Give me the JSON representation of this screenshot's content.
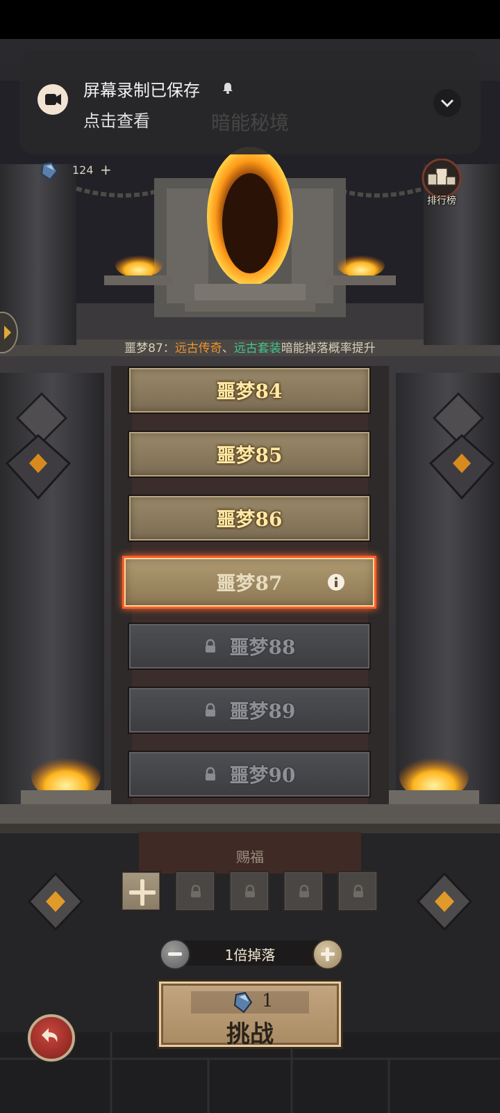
{
  "notification": {
    "title": "屏幕录制已保存",
    "subtitle": "点击查看",
    "icon": "video-camera-icon",
    "expand_icon": "chevron-down-icon"
  },
  "header": {
    "title": "暗能秘境"
  },
  "currency": {
    "icon": "crystal-gem-icon",
    "count": "124",
    "add": "+"
  },
  "leaderboard": {
    "label": "排行榜",
    "icon": "podium-icon"
  },
  "notice": {
    "prefix": "噩梦87：",
    "item1": "远古传奇",
    "separator": "、",
    "item2": "远古套装",
    "suffix": "暗能掉落概率提升",
    "color_item1": "#f0932c",
    "color_item2": "#43c88d"
  },
  "levels": [
    {
      "label": "噩梦84",
      "state": "open"
    },
    {
      "label": "噩梦85",
      "state": "open"
    },
    {
      "label": "噩梦86",
      "state": "open"
    },
    {
      "label": "噩梦87",
      "state": "selected"
    },
    {
      "label": "噩梦88",
      "state": "locked"
    },
    {
      "label": "噩梦89",
      "state": "locked"
    },
    {
      "label": "噩梦90",
      "state": "locked"
    }
  ],
  "blessing": {
    "title": "赐福",
    "slots_locked": 4
  },
  "drop": {
    "label": "1倍掉落",
    "minus": "−",
    "plus": "+"
  },
  "challenge": {
    "cost": "1",
    "label": "挑战"
  },
  "colors": {
    "accent_selected": "#ff5b2a",
    "level_open_text": "#ffe9a6",
    "level_locked_text": "#8f9096"
  }
}
